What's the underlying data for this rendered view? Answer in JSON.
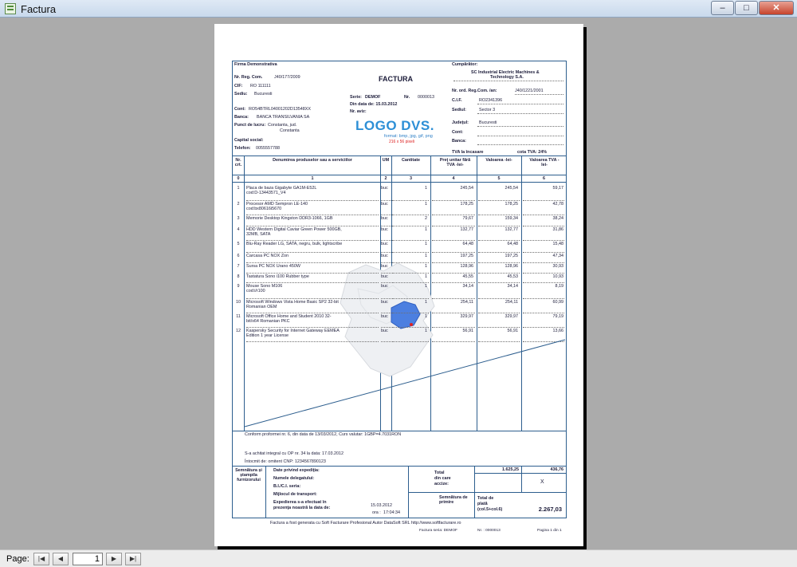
{
  "window": {
    "title": "Factura",
    "min": "–",
    "max": "□",
    "close": "✕"
  },
  "status": {
    "page_label": "Page:",
    "page_value": "1"
  },
  "invoice": {
    "supplier": {
      "name": "Firma Demonstrativa",
      "reg_label": "Nr. Reg. Com.",
      "reg": "J40/177/2009",
      "cif_label": "CIF:",
      "cif": "RO 111111",
      "sediu_label": "Sediu:",
      "sediu": "Bucuresti",
      "cont_label": "Cont:",
      "cont": "RO54BTRL04001202D13548XX",
      "banca_label": "Banca:",
      "banca": "BANCA TRANSILVANIA SA",
      "punct_label": "Punct de lucru:",
      "punct1": "Constanta, jud.",
      "punct2": "Constanta",
      "capital_label": "Capital social:",
      "tel_label": "Telefon:",
      "tel": "0055557788"
    },
    "title": "FACTURA",
    "serie_label": "Serie:",
    "serie": "DEMOF",
    "nr_label": "Nr.",
    "nr": "0000013",
    "din_data": "Din data de: 15.03.2012",
    "nr_aviz": "Nr. aviz:",
    "logo": {
      "text": "LOGO DVS.",
      "sub1": "format: bmp, jpg, gif, png",
      "sub2": "216 x 56 pixeli"
    },
    "client": {
      "title": "Cumpărător:",
      "name1": "SC Industrial Electric Machines &",
      "name2": "Technology S.A.",
      "reg_label": "Nr. ord. Reg.Com. /an:",
      "reg": "J40/1221/2001",
      "cif_label": "C.I.F.",
      "cif": "RO2341396",
      "sediu_label": "Sediul:",
      "sediu": "Sector 3",
      "judet_label": "Judeţul:",
      "judet": "Bucuresti",
      "cont_label": "Cont:",
      "banca_label": "Banca:",
      "tva_incasare": "TVA la încasare",
      "cota_tva": "cota TVA: 24%"
    },
    "headers": {
      "nr": "Nr. crt.",
      "den": "Denumirea produselor sau a serviciilor",
      "um": "UM",
      "cant": "Cantitate",
      "pu": "Preţ unitar fără TVA -lei-",
      "val": "Valoarea -lei-",
      "tva": "Valoarea TVA -lei-"
    },
    "col_numbers": [
      "0",
      "1",
      "2",
      "3",
      "4",
      "5",
      "6"
    ],
    "items": [
      {
        "nr": "1",
        "name1": "Placa de baza Gigabyte GA1M-E52L",
        "name2": "cod:D-13443571_V4",
        "um": "buc",
        "qty": "1",
        "price": "245,54",
        "value": "245,54",
        "tva": "59,17"
      },
      {
        "nr": "2",
        "name1": "Procesor AMD Sempron LE-140",
        "name2": "cod:bx80616i5670",
        "um": "buc",
        "qty": "1",
        "price": "178,25",
        "value": "178,25",
        "tva": "42,78"
      },
      {
        "nr": "3",
        "name1": "Memorie Desktop Kingston DDR3-1066, 1GB",
        "name2": "",
        "um": "buc",
        "qty": "2",
        "price": "79,67",
        "value": "159,34",
        "tva": "38,24"
      },
      {
        "nr": "4",
        "name1": "HDD Western Digital Caviar Green Power 500GB,",
        "name2": "32MB, SATA",
        "um": "buc",
        "qty": "1",
        "price": "132,77",
        "value": "132,77",
        "tva": "31,86"
      },
      {
        "nr": "5",
        "name1": "Blu-Ray Reader LG, SATA, negru, bulk, lightscribe",
        "name2": "",
        "um": "buc",
        "qty": "1",
        "price": "64,48",
        "value": "64,48",
        "tva": "15,48"
      },
      {
        "nr": "6",
        "name1": "Carcasa PC NOX Zon",
        "name2": "",
        "um": "buc",
        "qty": "1",
        "price": "197,25",
        "value": "197,25",
        "tva": "47,34"
      },
      {
        "nr": "7",
        "name1": "Sursa PC NOX Urano 450W",
        "name2": "",
        "um": "buc",
        "qty": "1",
        "price": "128,96",
        "value": "128,96",
        "tva": "30,93"
      },
      {
        "nr": "8",
        "name1": "Tastatura Sono i100 Rubber type",
        "name2": "",
        "um": "buc",
        "qty": "1",
        "price": "45,55",
        "value": "45,53",
        "tva": "10,93"
      },
      {
        "nr": "9",
        "name1": "Mouse Sono M106",
        "name2": "cod:i/r100",
        "um": "buc",
        "qty": "1",
        "price": "34,14",
        "value": "34,14",
        "tva": "8,19"
      },
      {
        "nr": "10",
        "name1": "Microsoft Windows Vista Home Basic SP2 32-bit",
        "name2": "Romanian OEM",
        "um": "buc",
        "qty": "1",
        "price": "254,11",
        "value": "254,11",
        "tva": "60,99"
      },
      {
        "nr": "11",
        "name1": "Microsoft Office Home and Student 2010 32-",
        "name2": "bit/x64 Romanian PKC",
        "um": "buc",
        "qty": "1",
        "price": "329,97",
        "value": "329,97",
        "tva": "79,19"
      },
      {
        "nr": "12",
        "name1": "Kaspersky Security for Internet Gateway EEMEA",
        "name2": "Edition 1 year License",
        "um": "buc",
        "qty": "1",
        "price": "56,91",
        "value": "56,91",
        "tva": "13,66"
      }
    ],
    "footer_note1": "Conform proformei nr. 6, din data de 13/03/2012, Curs valutar: 1GBP=4.7031RON",
    "footer_note2": "S-a achitat integral cu OP nr. 34 la data: 17.03.2012",
    "footer_note3": "Întocmit de: omitent  CNP: 1234567890123",
    "sig_supplier": "Semnătura și ștampila furnizorului",
    "exp": {
      "title": "Date privind expediţia:",
      "delegat": "Numele delegatului:",
      "bi": "B.I./C.I. seria:",
      "mijloc": "Mijlocul de transport:",
      "exped1": "Expedierea s-a efectuat în",
      "exped2": "prezenţa noastră la data de:",
      "date": "15.03.2012",
      "ora_label": "ora :",
      "ora": "17:04:34"
    },
    "totals": {
      "total_label": "Total",
      "din_care": "din care",
      "accize": "accize:",
      "total_val": "1.625,25",
      "total_tva": "436,76",
      "accize_val": "X",
      "sig_primire": "Semnătura de primire",
      "plata_label1": "Total de",
      "plata_label2": "plată",
      "plata_label3": "(col.5+col.6)",
      "plata_val": "2.267,03"
    },
    "generated": "Factura a fost generata cu Soft Facturare Profesional Autor DataSoft SRL http://www.softfacturare.ro",
    "bottom_serie": "Factura seria:  DEMOF",
    "bottom_nr": "Nr.  :  0000013",
    "bottom_page": "Pagina 1 din 1"
  }
}
